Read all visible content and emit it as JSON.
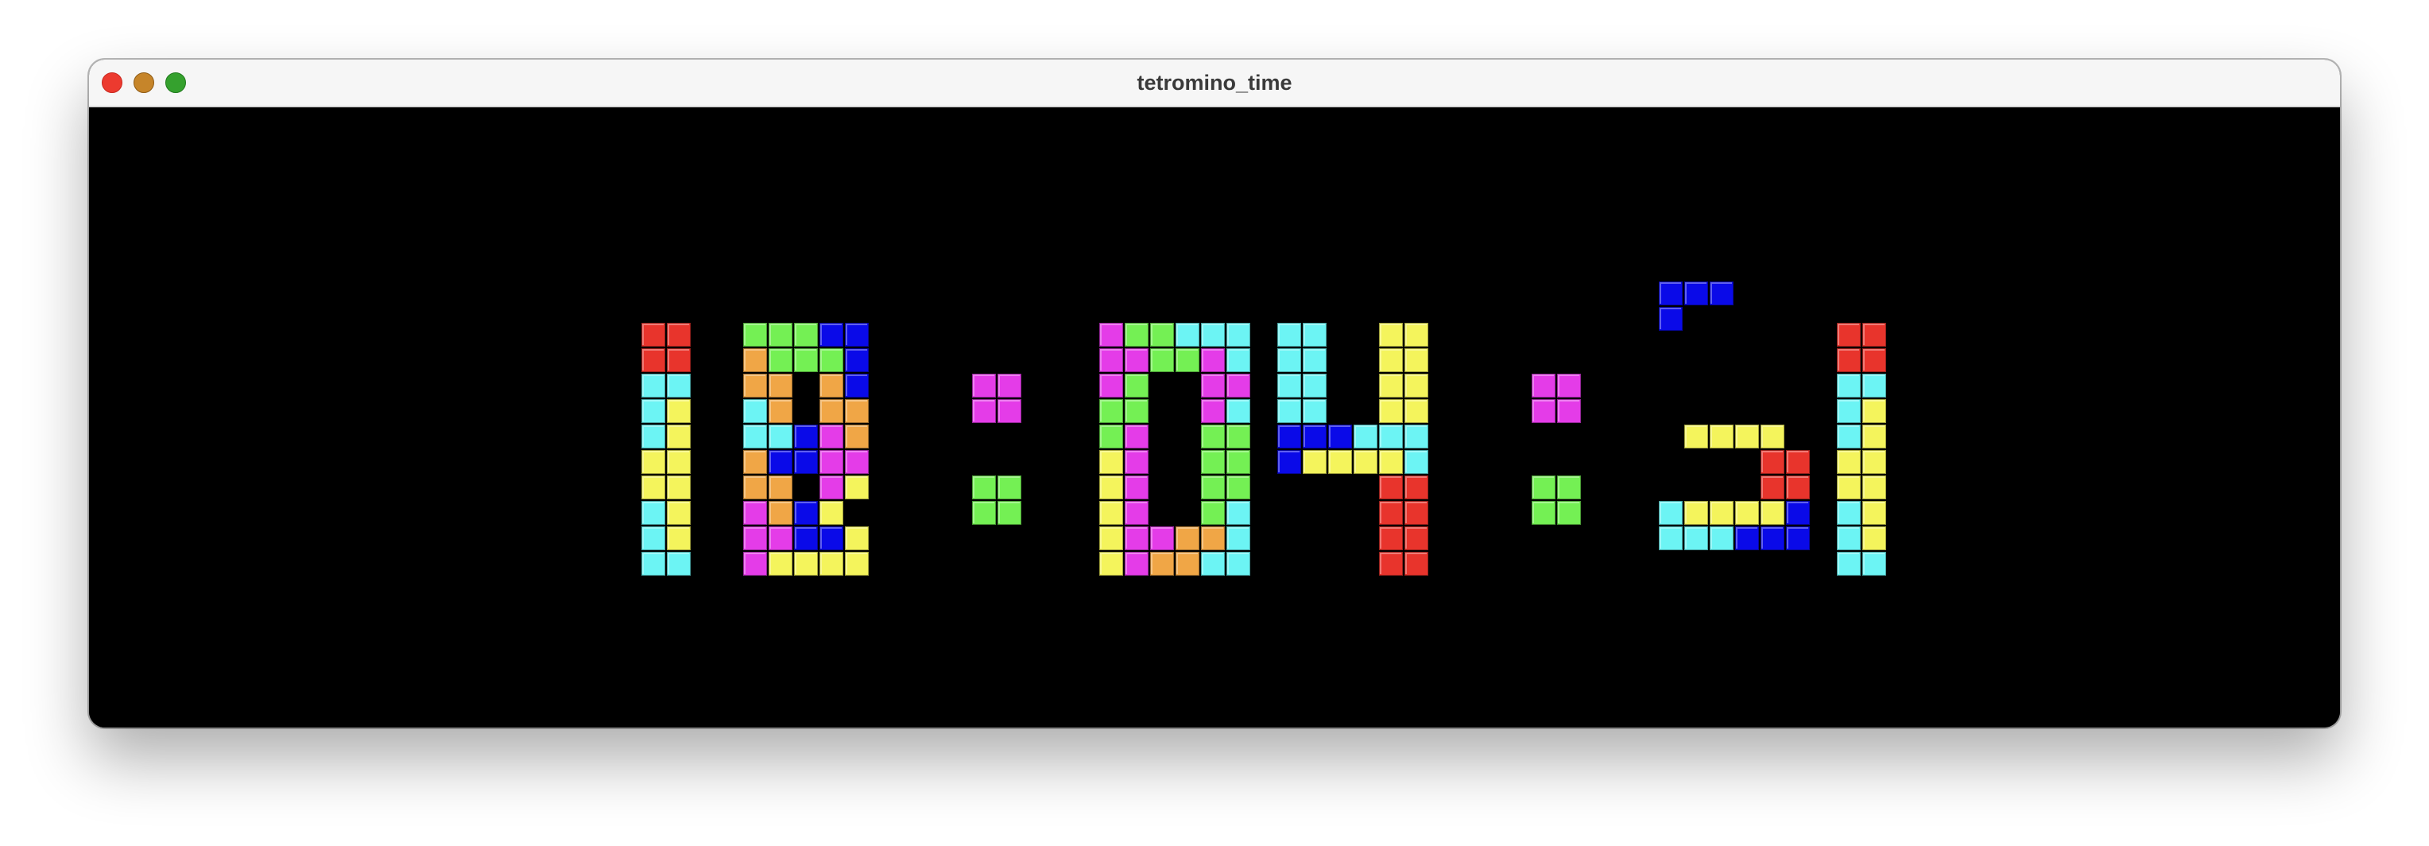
{
  "window": {
    "title": "tetromino_time"
  },
  "clock": {
    "time": "18:04:51",
    "colors": {
      "red": "#e8342c",
      "cyan": "#6cf4f4",
      "yellow": "#f4f45c",
      "green": "#74f054",
      "orange": "#f0a646",
      "blue": "#0a0ae8",
      "magenta": "#e43ce8"
    }
  }
}
